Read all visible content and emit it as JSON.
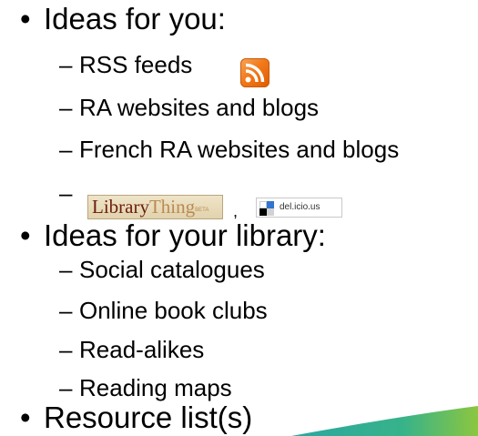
{
  "bullets": [
    {
      "text": "Ideas for you:"
    },
    {
      "text": "Ideas for your library:"
    },
    {
      "text": "Resource list(s)"
    }
  ],
  "ideas_for_you": [
    {
      "text": "RSS feeds"
    },
    {
      "text": "RA websites and blogs"
    },
    {
      "text": "French RA websites and blogs"
    },
    {
      "text": ""
    }
  ],
  "ideas_for_library": [
    {
      "text": "Social catalogues"
    },
    {
      "text": "Online book clubs"
    },
    {
      "text": "Read-alikes"
    },
    {
      "text": "Reading maps"
    }
  ],
  "symbols": {
    "bullet": "•",
    "dash": "–",
    "comma": ","
  },
  "logos": {
    "librarything_part1": "Library",
    "librarything_part2": "Thing",
    "librarything_beta": "BETA",
    "delicious": "del.icio.us"
  },
  "icons": {
    "rss": "rss-feed-icon",
    "librarything": "librarything-logo",
    "delicious": "delicious-logo"
  },
  "colors": {
    "text": "#000000",
    "rss_orange": "#f27a1a",
    "librarything_red": "#6b1e0e",
    "librarything_tan": "#b98a53",
    "swoosh_teal": "#2aa7a0",
    "swoosh_green": "#8cc63f"
  }
}
